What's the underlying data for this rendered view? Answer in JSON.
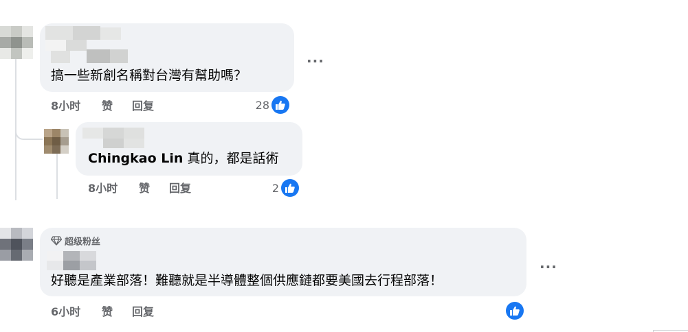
{
  "comments": [
    {
      "text": "搞一些新創名稱對台灣有幫助嗎？",
      "time": "8小时",
      "like_label": "赞",
      "reply_label": "回复",
      "reaction_count": "28",
      "reaction_icon": "like-icon"
    },
    {
      "tag": "Chingkao Lin",
      "text": "真的，都是話術",
      "time": "8小时",
      "like_label": "赞",
      "reply_label": "回复",
      "reaction_count": "2",
      "reaction_icon": "like-icon"
    },
    {
      "badge": "超级粉丝",
      "badge_icon": "diamond-icon",
      "text": "好聽是產業部落！難聽就是半導體整個供應鏈都要美國去行程部落！",
      "time": "6小时",
      "like_label": "赞",
      "reply_label": "回复",
      "reaction_count": "",
      "reaction_icon": "like-icon"
    }
  ],
  "more_options": "...",
  "colors": {
    "bubble": "#f0f2f5",
    "like_blue": "#1877f2",
    "meta_gray": "#65676b"
  }
}
